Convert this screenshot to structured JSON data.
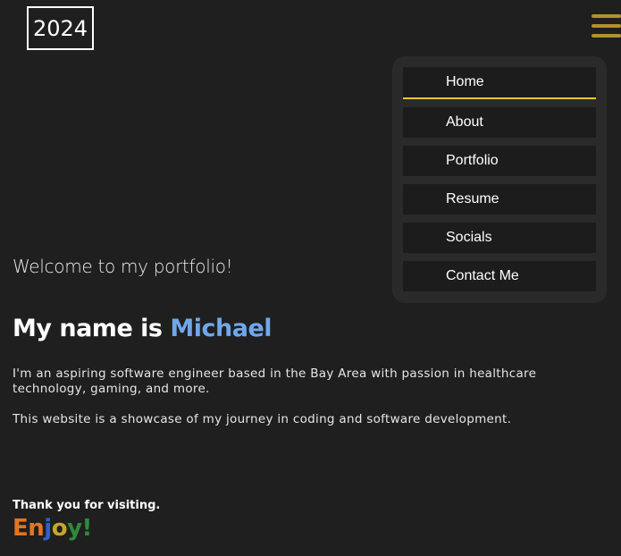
{
  "header": {
    "logo_text": "2024",
    "menu_icon": "hamburger-menu-icon",
    "menu_color": "#b3922c"
  },
  "nav": {
    "items": [
      {
        "label": "Home",
        "active": true
      },
      {
        "label": "About",
        "active": false
      },
      {
        "label": "Portfolio",
        "active": false
      },
      {
        "label": "Resume",
        "active": false
      },
      {
        "label": "Socials",
        "active": false
      },
      {
        "label": "Contact Me",
        "active": false
      }
    ],
    "active_underline_color": "#e8c530"
  },
  "main": {
    "welcome": "Welcome to my portfolio!",
    "name_prefix": "My name is ",
    "name_highlight": "Michael",
    "highlight_color": "#6fa8ea",
    "intro": "I'm an aspiring software engineer based in the Bay Area with passion in healthcare technology, gaming, and more.",
    "showcase": "This website is a showcase of my journey in coding and software development.",
    "thanks": "Thank you for visiting.",
    "enjoy": {
      "text": "Enjoy!",
      "letters": [
        {
          "char": "E",
          "color": "#e8731c"
        },
        {
          "char": "n",
          "color": "#e8731c"
        },
        {
          "char": "j",
          "color": "#2f5fd0"
        },
        {
          "char": "o",
          "color": "#c9a52a"
        },
        {
          "char": "y",
          "color": "#2e8b3a"
        },
        {
          "char": "!",
          "color": "#2e8b3a"
        }
      ]
    }
  }
}
